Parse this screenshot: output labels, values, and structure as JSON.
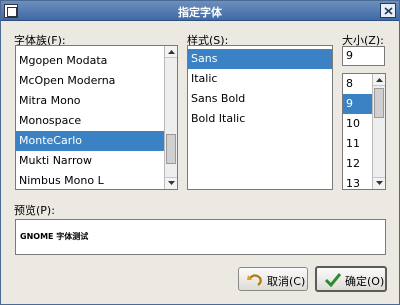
{
  "window": {
    "title": "指定字体"
  },
  "family": {
    "label": "字体族(F):",
    "items": [
      "Mgopen Modata",
      "McOpen Moderna",
      "Mitra Mono",
      "Monospace",
      "MonteCarlo",
      "Mukti Narrow",
      "Nimbus Mono L"
    ],
    "selected": "MonteCarlo"
  },
  "style": {
    "label": "样式(S):",
    "items": [
      "Sans",
      "Italic",
      "Sans Bold",
      "Bold Italic"
    ],
    "selected": "Sans"
  },
  "size": {
    "label": "大小(Z):",
    "value": "9",
    "items": [
      "8",
      "9",
      "10",
      "11",
      "12",
      "13"
    ],
    "selected": "9"
  },
  "preview": {
    "label": "预览(P):",
    "text": "GNOME 字体测试"
  },
  "buttons": {
    "cancel": "取消(C)",
    "ok": "确定(O)"
  },
  "colors": {
    "selection": "#3b82c4",
    "titlebar": "#4d77ae"
  }
}
